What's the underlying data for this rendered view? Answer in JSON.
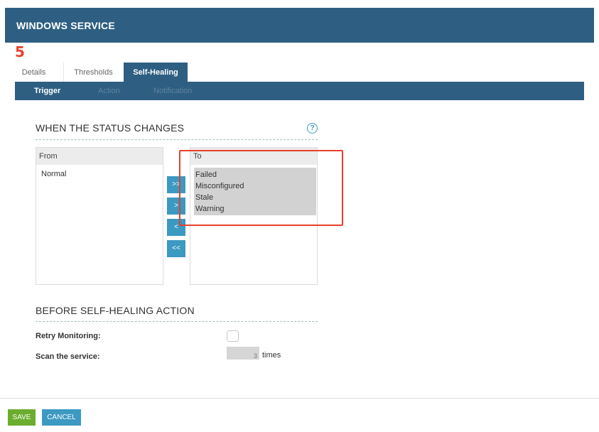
{
  "header": {
    "title": "WINDOWS SERVICE"
  },
  "step_badge": "5",
  "tabs": [
    {
      "label": "Details"
    },
    {
      "label": "Thresholds"
    },
    {
      "label": "Self-Healing"
    }
  ],
  "subnav": [
    {
      "label": "Trigger"
    },
    {
      "label": "Action"
    },
    {
      "label": "Notification"
    }
  ],
  "status_section": {
    "title": "WHEN THE STATUS CHANGES",
    "help_icon": "?",
    "from": {
      "header": "From",
      "items": [
        "Normal"
      ]
    },
    "to": {
      "header": "To",
      "items": [
        "Failed",
        "Misconfigured",
        "Stale",
        "Warning"
      ]
    },
    "move_buttons": [
      ">>",
      ">",
      "<",
      "<<"
    ]
  },
  "before_section": {
    "title": "BEFORE SELF-HEALING ACTION",
    "retry_label": "Retry Monitoring:",
    "scan_label": "Scan the service:",
    "scan_value": "3",
    "times_label": "times"
  },
  "footer": {
    "save_label": "SAVE",
    "cancel_label": "CANCEL"
  },
  "colors": {
    "header": "#2e5f82",
    "accent": "#3b99c2",
    "save": "#6bad2e",
    "highlight": "#e8402a"
  }
}
